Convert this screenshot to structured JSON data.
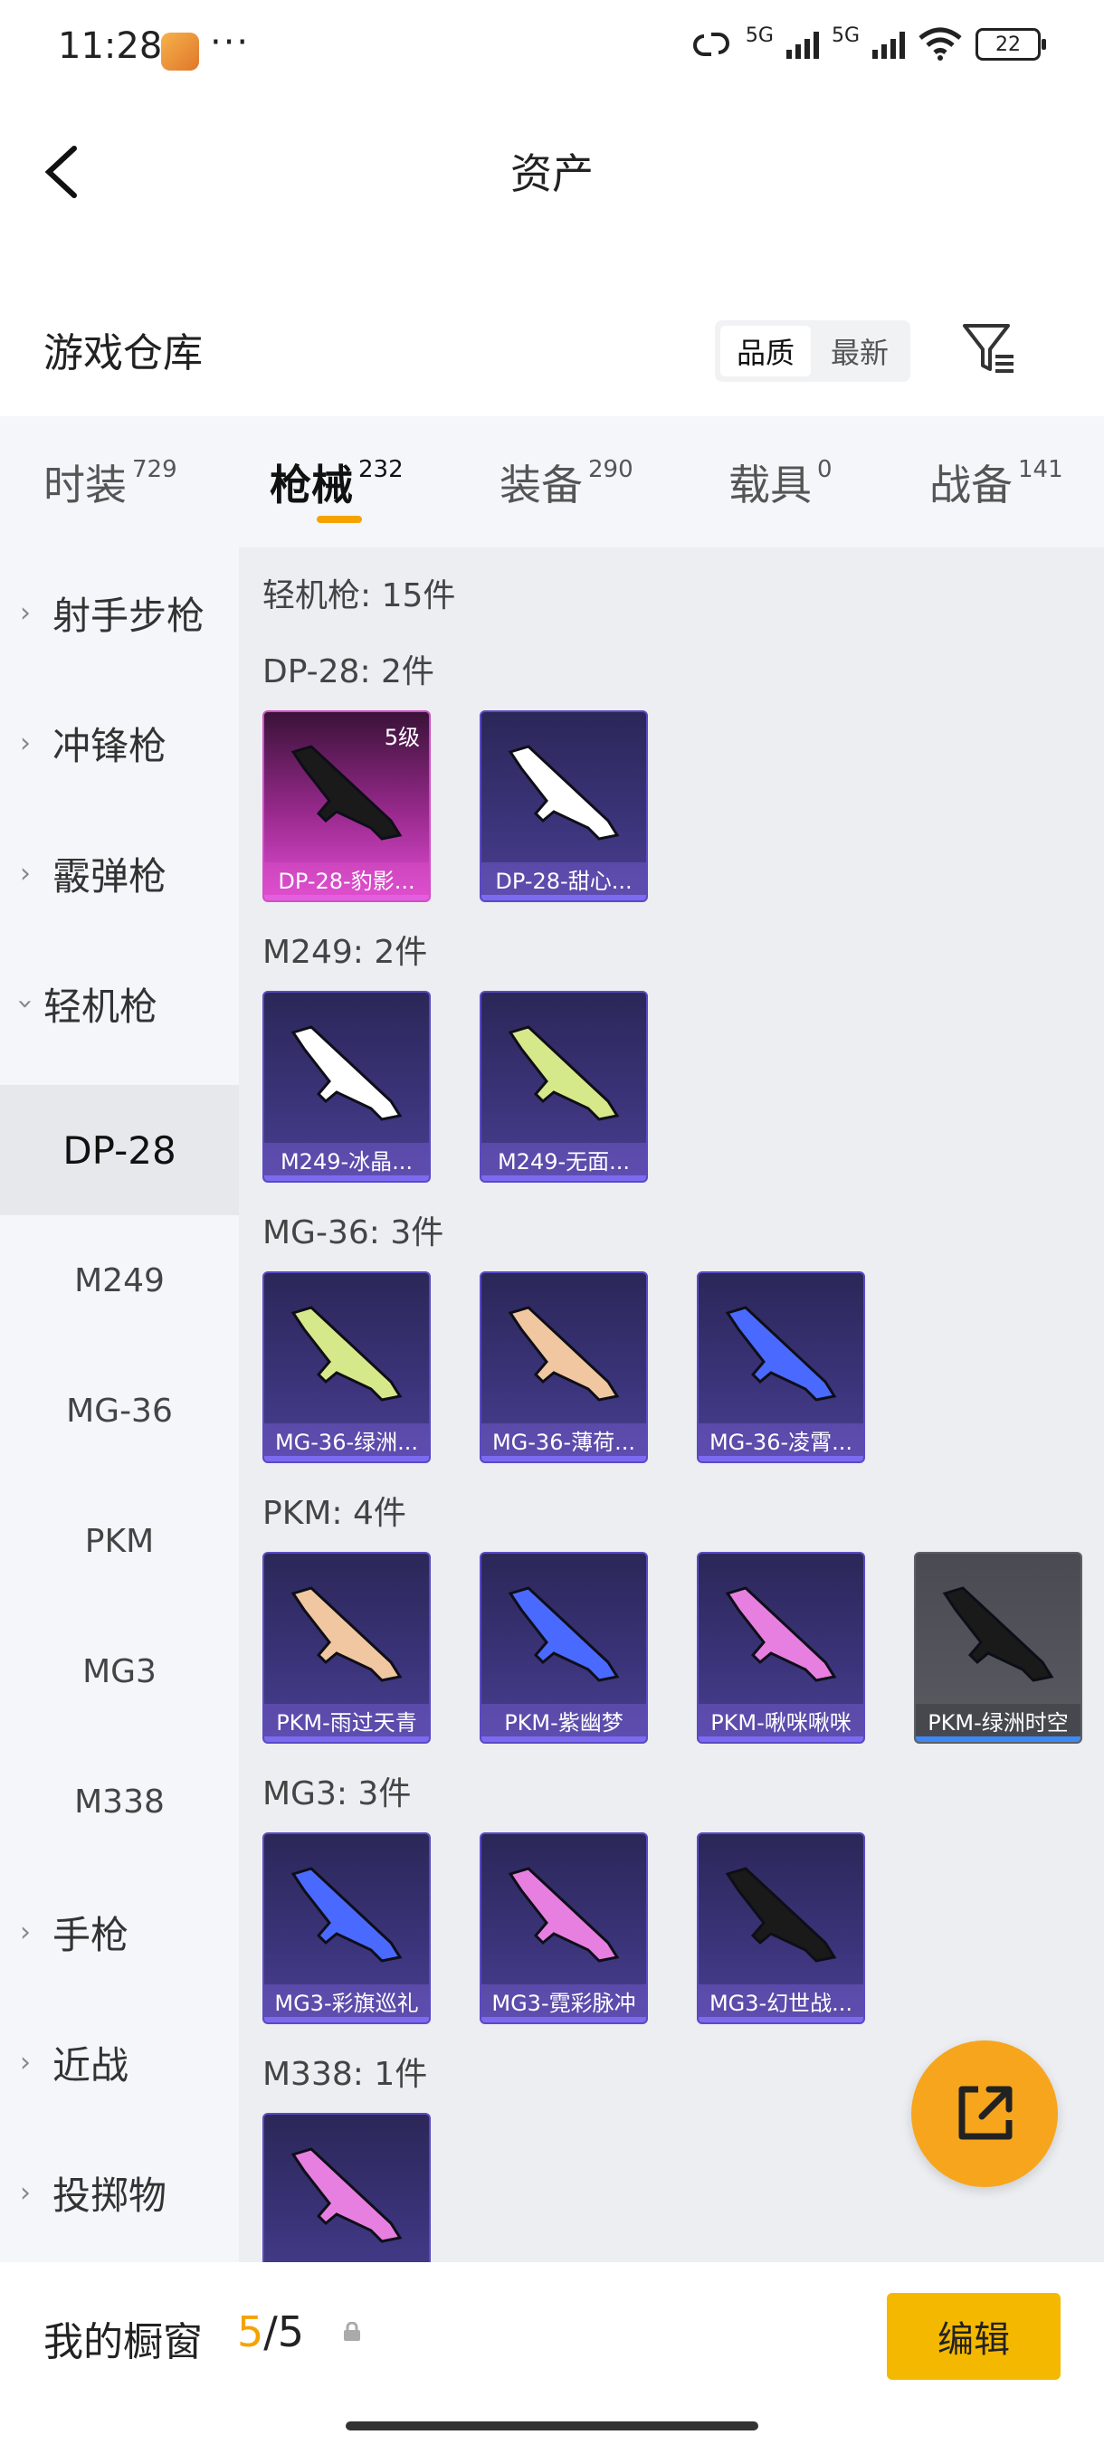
{
  "status_bar": {
    "time": "11:28",
    "more": "···",
    "net1": "5G",
    "net2": "5G",
    "battery": "22"
  },
  "header": {
    "title": "资产"
  },
  "warehouse": {
    "title": "游戏仓库",
    "sort_quality": "品质",
    "sort_newest": "最新"
  },
  "category_tabs": [
    {
      "label": "时装",
      "count": "729"
    },
    {
      "label": "枪械",
      "count": "232",
      "active": true
    },
    {
      "label": "装备",
      "count": "290"
    },
    {
      "label": "载具",
      "count": "0"
    },
    {
      "label": "战备",
      "count": "141"
    }
  ],
  "sidebar": {
    "items": [
      {
        "label": "射手步枪"
      },
      {
        "label": "冲锋枪"
      },
      {
        "label": "霰弹枪"
      },
      {
        "label": "轻机枪",
        "expanded": true
      }
    ],
    "sub_items": [
      "DP-28",
      "M249",
      "MG-36",
      "PKM",
      "MG3",
      "M338"
    ],
    "items_after": [
      {
        "label": "手枪"
      },
      {
        "label": "近战"
      },
      {
        "label": "投掷物"
      }
    ]
  },
  "main": {
    "category_total": "轻机枪: 15件",
    "groups": [
      {
        "title": "DP-28: 2件",
        "items": [
          {
            "name": "DP-28-豹影...",
            "rarity": "pink",
            "level": "5级"
          },
          {
            "name": "DP-28-甜心...",
            "rarity": "purple"
          }
        ]
      },
      {
        "title": "M249: 2件",
        "items": [
          {
            "name": "M249-冰晶...",
            "rarity": "purple"
          },
          {
            "name": "M249-无面...",
            "rarity": "purple"
          }
        ]
      },
      {
        "title": "MG-36: 3件",
        "items": [
          {
            "name": "MG-36-绿洲...",
            "rarity": "purple"
          },
          {
            "name": "MG-36-薄荷...",
            "rarity": "purple"
          },
          {
            "name": "MG-36-凌霄...",
            "rarity": "purple"
          }
        ]
      },
      {
        "title": "PKM: 4件",
        "items": [
          {
            "name": "PKM-雨过天青",
            "rarity": "purple"
          },
          {
            "name": "PKM-紫幽梦",
            "rarity": "purple"
          },
          {
            "name": "PKM-啾咪啾咪",
            "rarity": "purple"
          },
          {
            "name": "PKM-绿洲时空",
            "rarity": "gray"
          }
        ]
      },
      {
        "title": "MG3: 3件",
        "items": [
          {
            "name": "MG3-彩旗巡礼",
            "rarity": "purple"
          },
          {
            "name": "MG3-霓彩脉冲",
            "rarity": "purple"
          },
          {
            "name": "MG3-幻世战...",
            "rarity": "purple"
          }
        ]
      },
      {
        "title": "M338: 1件",
        "items": [
          {
            "name": "",
            "rarity": "purple"
          }
        ]
      }
    ]
  },
  "bottom_bar": {
    "label": "我的橱窗",
    "count_current": "5",
    "count_sep": "/",
    "count_max": "5",
    "edit_label": "编辑"
  }
}
